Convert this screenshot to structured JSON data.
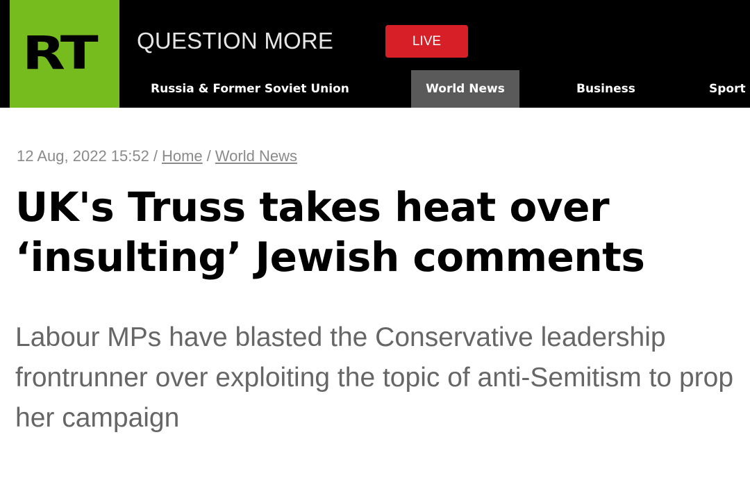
{
  "header": {
    "logo_text": "RT",
    "tagline": "QUESTION MORE",
    "live_label": "LIVE",
    "colors": {
      "logo_green": "#77bc1f",
      "live_red": "#d61f26",
      "nav_active_bg": "#5a5a5a"
    }
  },
  "nav": {
    "items": [
      {
        "label": "Russia & Former Soviet Union",
        "active": false
      },
      {
        "label": "World News",
        "active": true
      },
      {
        "label": "Business",
        "active": false
      },
      {
        "label": "Sport",
        "active": false
      }
    ]
  },
  "article": {
    "date": "12 Aug, 2022 15:52",
    "breadcrumb_home": "Home",
    "breadcrumb_section": "World News",
    "separator": "/",
    "headline_line1": "UK's Truss takes heat over",
    "headline_line2": "‘insulting’ Jewish comments",
    "summary": "Labour MPs have blasted the Conservative leadership frontrunner over exploiting the topic of anti-Semitism to prop her campaign"
  }
}
